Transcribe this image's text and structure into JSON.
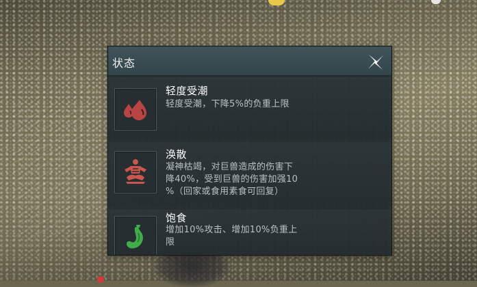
{
  "panel": {
    "title": "状态",
    "close_icon": "close-x-icon"
  },
  "status_effects": [
    {
      "name": "轻度受潮",
      "icon": "water-drops-icon",
      "icon_color": "#c04a4a",
      "description_lines": [
        "轻度受潮，下降5%的负重上限"
      ]
    },
    {
      "name": "涣散",
      "icon": "meditating-figure-icon",
      "icon_color": "#c9574b",
      "description_lines": [
        "凝神枯竭，对巨兽造成的伤害下",
        "降40%，受到巨兽的伤害加强10",
        "%（回家或食用素食可回复）"
      ]
    },
    {
      "name": "饱食",
      "icon": "stomach-icon",
      "icon_color": "#3fae4a",
      "description_lines": [
        "增加10%攻击、增加10%负重上",
        "限"
      ]
    }
  ]
}
